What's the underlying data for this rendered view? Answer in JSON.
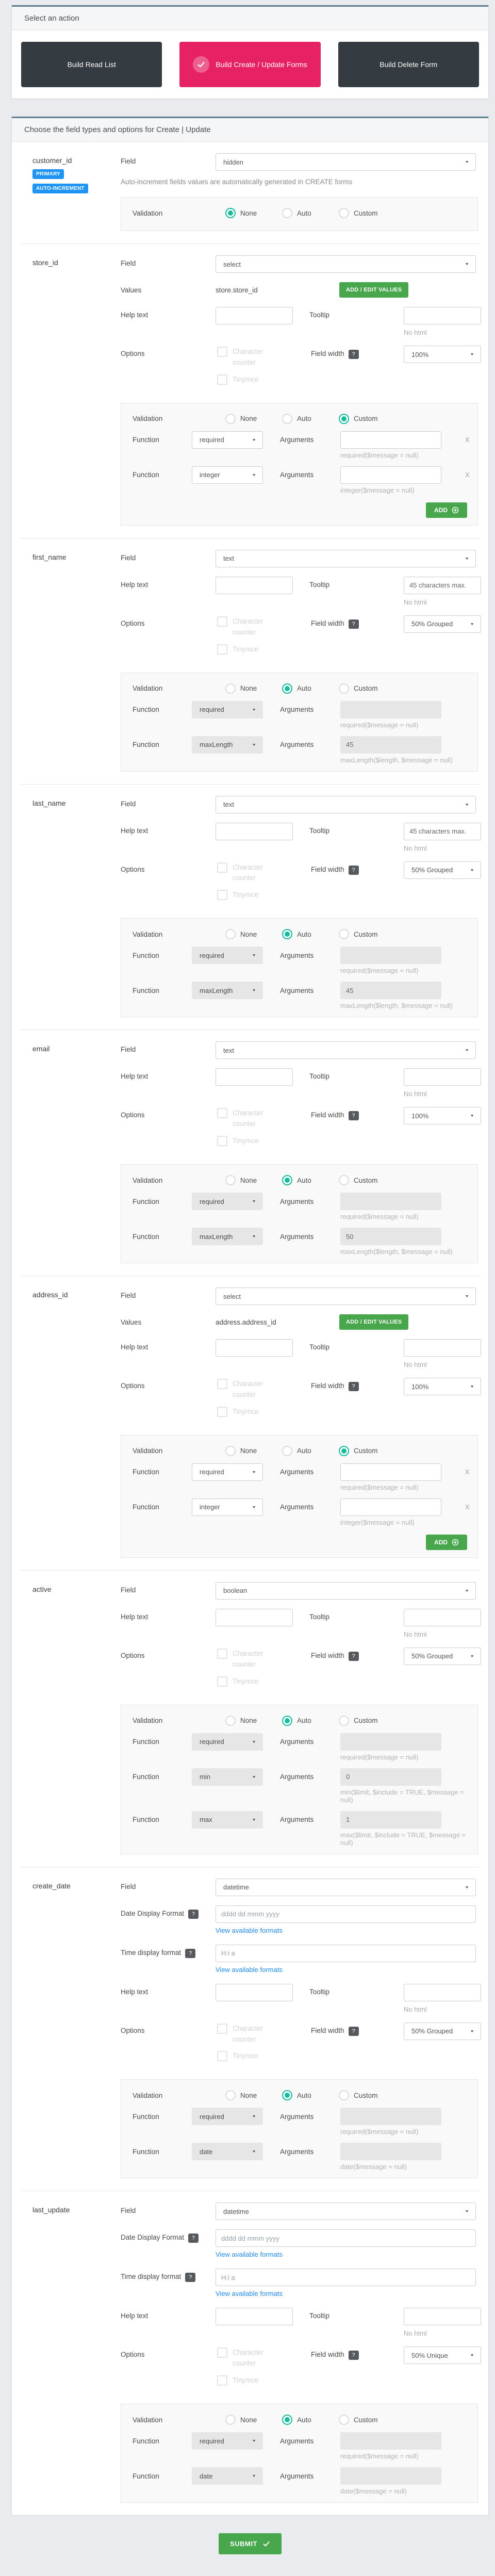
{
  "colors": {
    "page_background": "#e9ebee",
    "card_accent_top": "#5b7d8e",
    "dark_button": "#343b41",
    "active_pink": "#e72264",
    "primary_blue_badge": "#2094f3",
    "green_button": "#48a64c",
    "selected_radio_teal": "#18bc9c",
    "link_blue": "#1e88e5"
  },
  "action_panel": {
    "title": "Select an action",
    "buttons": [
      {
        "label": "Build Read List",
        "active": false
      },
      {
        "label": "Build Create / Update Forms",
        "active": true
      },
      {
        "label": "Build Delete Form",
        "active": false
      }
    ]
  },
  "fields_panel": {
    "title": "Choose the field types and options for Create | Update",
    "labels": {
      "field": "Field",
      "values": "Values",
      "help_text": "Help text",
      "tooltip": "Tooltip",
      "no_html": "No html",
      "options": "Options",
      "character_counter": "Character counter",
      "tinymce": "Tinymce",
      "field_width": "Field width",
      "validation": "Validation",
      "function": "Function",
      "arguments": "Arguments",
      "add": "ADD",
      "add_edit_values": "ADD / EDIT VALUES",
      "date_display_format": "Date Display Format",
      "time_display_format": "Time display format",
      "view_formats": "View available formats",
      "remove": "X",
      "help_badge": "?",
      "radio_options": [
        "None",
        "Auto",
        "Custom"
      ]
    },
    "sections": [
      {
        "name": "customer_id",
        "badges": [
          "PRIMARY",
          "AUTO-INCREMENT"
        ],
        "field_type": "hidden",
        "note": "Auto-increment fields values are automatically generated in CREATE forms",
        "validation": {
          "mode": "None",
          "functions": []
        }
      },
      {
        "name": "store_id",
        "field_type": "select",
        "values_text": "store.store_id",
        "help_text": "",
        "tooltip": "",
        "field_width": "100%",
        "validation": {
          "mode": "Custom",
          "functions": [
            {
              "name": "required",
              "args": "",
              "hint": "required($message = null)"
            },
            {
              "name": "integer",
              "args": "",
              "hint": "integer($message = null)"
            }
          ]
        }
      },
      {
        "name": "first_name",
        "field_type": "text",
        "help_text": "",
        "tooltip": "45 characters max.",
        "field_width": "50% Grouped",
        "validation": {
          "mode": "Auto",
          "functions": [
            {
              "name": "required",
              "args": "",
              "hint": "required($message = null)"
            },
            {
              "name": "maxLength",
              "args": "45",
              "hint": "maxLength($length, $message = null)"
            }
          ]
        }
      },
      {
        "name": "last_name",
        "field_type": "text",
        "help_text": "",
        "tooltip": "45 characters max.",
        "field_width": "50% Grouped",
        "validation": {
          "mode": "Auto",
          "functions": [
            {
              "name": "required",
              "args": "",
              "hint": "required($message = null)"
            },
            {
              "name": "maxLength",
              "args": "45",
              "hint": "maxLength($length, $message = null)"
            }
          ]
        }
      },
      {
        "name": "email",
        "field_type": "text",
        "help_text": "",
        "tooltip": "",
        "field_width": "100%",
        "validation": {
          "mode": "Auto",
          "functions": [
            {
              "name": "required",
              "args": "",
              "hint": "required($message = null)"
            },
            {
              "name": "maxLength",
              "args": "50",
              "hint": "maxLength($length, $message = null)"
            }
          ]
        }
      },
      {
        "name": "address_id",
        "field_type": "select",
        "values_text": "address.address_id",
        "help_text": "",
        "tooltip": "",
        "field_width": "100%",
        "validation": {
          "mode": "Custom",
          "functions": [
            {
              "name": "required",
              "args": "",
              "hint": "required($message = null)"
            },
            {
              "name": "integer",
              "args": "",
              "hint": "integer($message = null)"
            }
          ]
        }
      },
      {
        "name": "active",
        "field_type": "boolean",
        "help_text": "",
        "tooltip": "",
        "field_width": "50% Grouped",
        "validation": {
          "mode": "Auto",
          "functions": [
            {
              "name": "required",
              "args": "",
              "hint": "required($message = null)"
            },
            {
              "name": "min",
              "args": "0",
              "hint": "min($limit, $include = TRUE, $message = null)"
            },
            {
              "name": "max",
              "args": "1",
              "hint": "max($limit, $include = TRUE, $message = null)"
            }
          ]
        }
      },
      {
        "name": "create_date",
        "field_type": "datetime",
        "date_display_format": "dddd dd mmm yyyy",
        "time_display_format": "H:i a",
        "help_text": "",
        "tooltip": "",
        "field_width": "50% Grouped",
        "validation": {
          "mode": "Auto",
          "functions": [
            {
              "name": "required",
              "args": "",
              "hint": "required($message = null)"
            },
            {
              "name": "date",
              "args": "",
              "hint": "date($message = null)"
            }
          ]
        }
      },
      {
        "name": "last_update",
        "field_type": "datetime",
        "date_display_format": "dddd dd mmm yyyy",
        "time_display_format": "H:i a",
        "help_text": "",
        "tooltip": "",
        "field_width": "50% Unique",
        "validation": {
          "mode": "Auto",
          "functions": [
            {
              "name": "required",
              "args": "",
              "hint": "required($message = null)"
            },
            {
              "name": "date",
              "args": "",
              "hint": "date($message = null)"
            }
          ]
        }
      }
    ]
  },
  "submit": {
    "label": "SUBMIT"
  }
}
